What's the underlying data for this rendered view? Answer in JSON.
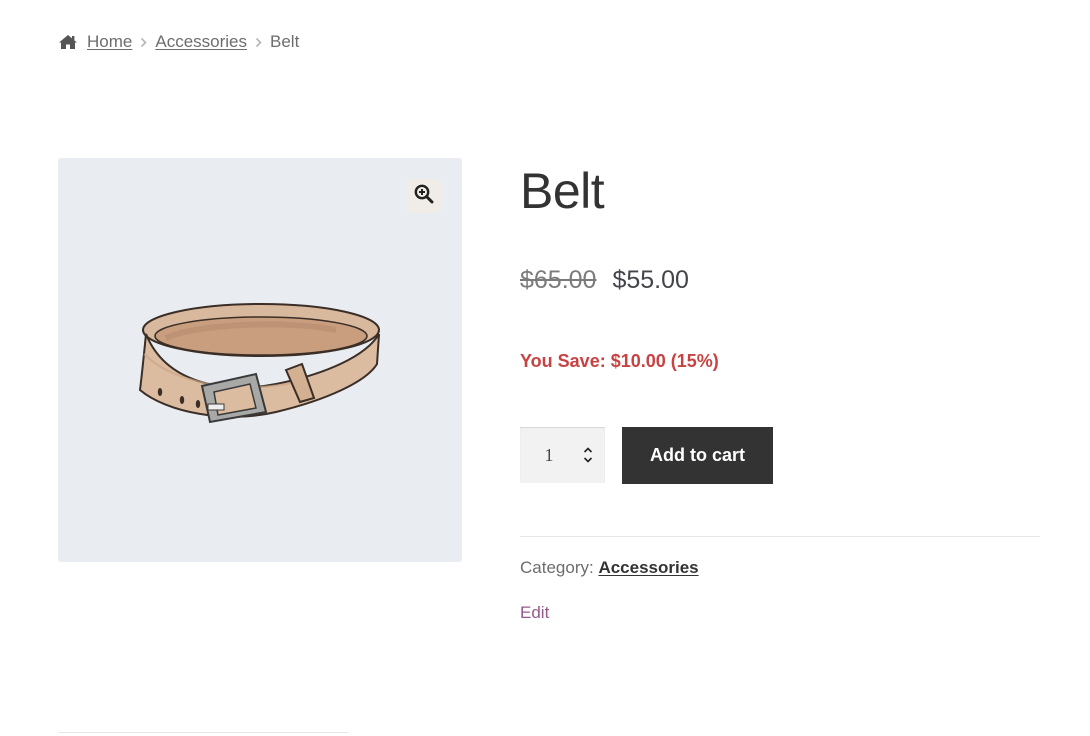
{
  "breadcrumb": {
    "home": "Home",
    "category": "Accessories",
    "current": "Belt"
  },
  "icons": {
    "home": "home-icon",
    "separator": "chevron-right-icon",
    "zoom": "zoom-in-icon",
    "spinner": "up-down-arrows-icon"
  },
  "product": {
    "title": "Belt",
    "regular_price": "$65.00",
    "sale_price": "$55.00",
    "savings": "You Save: $10.00 (15%)",
    "quantity": "1",
    "add_to_cart_label": "Add to cart",
    "category_label": "Category:",
    "category_value": "Accessories",
    "edit_label": "Edit"
  },
  "colors": {
    "savings": "#c94242",
    "button_bg": "#333333",
    "edit_link": "#96588a",
    "image_bg": "#e9edf2"
  }
}
